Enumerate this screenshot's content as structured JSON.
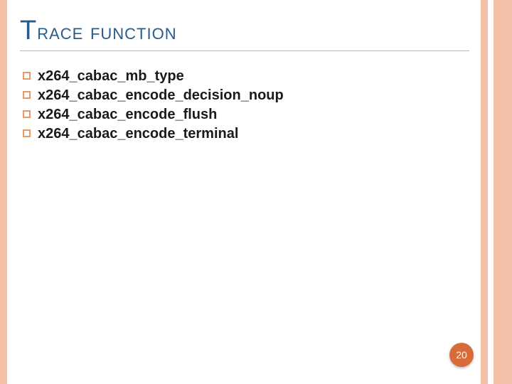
{
  "title_first": "T",
  "title_rest": "race function",
  "bullets": [
    "x264_cabac_mb_type",
    "x264_cabac_encode_decision_noup",
    "x264_cabac_encode_flush",
    "x264_cabac_encode_terminal"
  ],
  "page_number": "20"
}
